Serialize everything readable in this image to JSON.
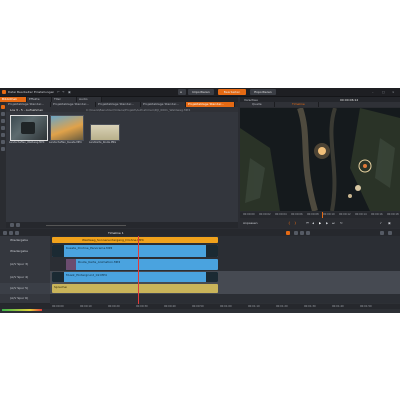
{
  "app": {
    "menu": [
      "Datei",
      "Bearbeiten",
      "Einstellungen"
    ],
    "modes": [
      "Importieren",
      "Bearbeiten",
      "Exportieren"
    ],
    "active_mode": "Bearbeiten"
  },
  "library": {
    "tabs": [
      "Bibliothek",
      "Effekte",
      "Titel",
      "Audio"
    ],
    "project_tabs": [
      "Projektablage Standar...",
      "Projektablage Standar...",
      "Projektablage Standar...",
      "Projektablage Standar...",
      "Projektablage Standar..."
    ],
    "folder_label": "Los 3 - 5 - Aufnahmen",
    "path_text": "C:\\Users\\Benutzer\\Videos\\Projekt\\Aufnahmen\\DJI_0001_Waldweg.MP4",
    "clips": [
      {
        "name": "Landschaften_Waldweg.MP4"
      },
      {
        "name": "Landschaften_Kueste.MP4"
      },
      {
        "name": "Landkarte_Route.PNG"
      }
    ]
  },
  "preview": {
    "title": "Vorschau",
    "tabs": [
      "Quelle",
      "Timeline"
    ],
    "timecode": "00:00:06:12",
    "ruler_ticks": [
      "00:00:00",
      "00:00:02",
      "00:00:04",
      "00:00:06",
      "00:00:08",
      "00:00:10",
      "00:00:12",
      "00:00:14",
      "00:00:16",
      "00:00:18"
    ],
    "zoom_label": "Anpassen"
  },
  "timeline": {
    "toolbar_label": "Timeline 1",
    "tracks": [
      {
        "name": "Wiedergabe",
        "clips": [
          {
            "label": "Waldweg_Sonnenuntergang_Drohne.MP4"
          }
        ]
      },
      {
        "name": "Wiedergabe",
        "clips": [
          {
            "label": "Kueste_Drohne_Panorama.MP4"
          }
        ]
      },
      {
        "name": "(A/V Spur 3)",
        "clips": [
          {
            "label": "Route_Karte_Animation.MP4"
          }
        ]
      },
      {
        "name": "(A/V Spur 4)",
        "clips": [
          {
            "label": "Musik_Hintergrund_02.MP4"
          }
        ]
      },
      {
        "name": "(A/V Spur 5)",
        "clips": [
          {
            "label": "Sprecher"
          }
        ]
      },
      {
        "name": "(A/V Spur 6)",
        "clips": []
      }
    ],
    "ruler_ticks": [
      "00:00:00",
      "00:00:10",
      "00:00:20",
      "00:00:30",
      "00:00:40",
      "00:00:50",
      "00:01:00",
      "00:01:10",
      "00:01:20",
      "00:01:30",
      "00:01:40",
      "00:01:50"
    ]
  },
  "colors": {
    "accent": "#e56a14",
    "clip_orange": "#f0a21c",
    "clip_blue": "#4aa3df",
    "clip_yellow": "#c9b45a",
    "panel": "#33363d"
  }
}
